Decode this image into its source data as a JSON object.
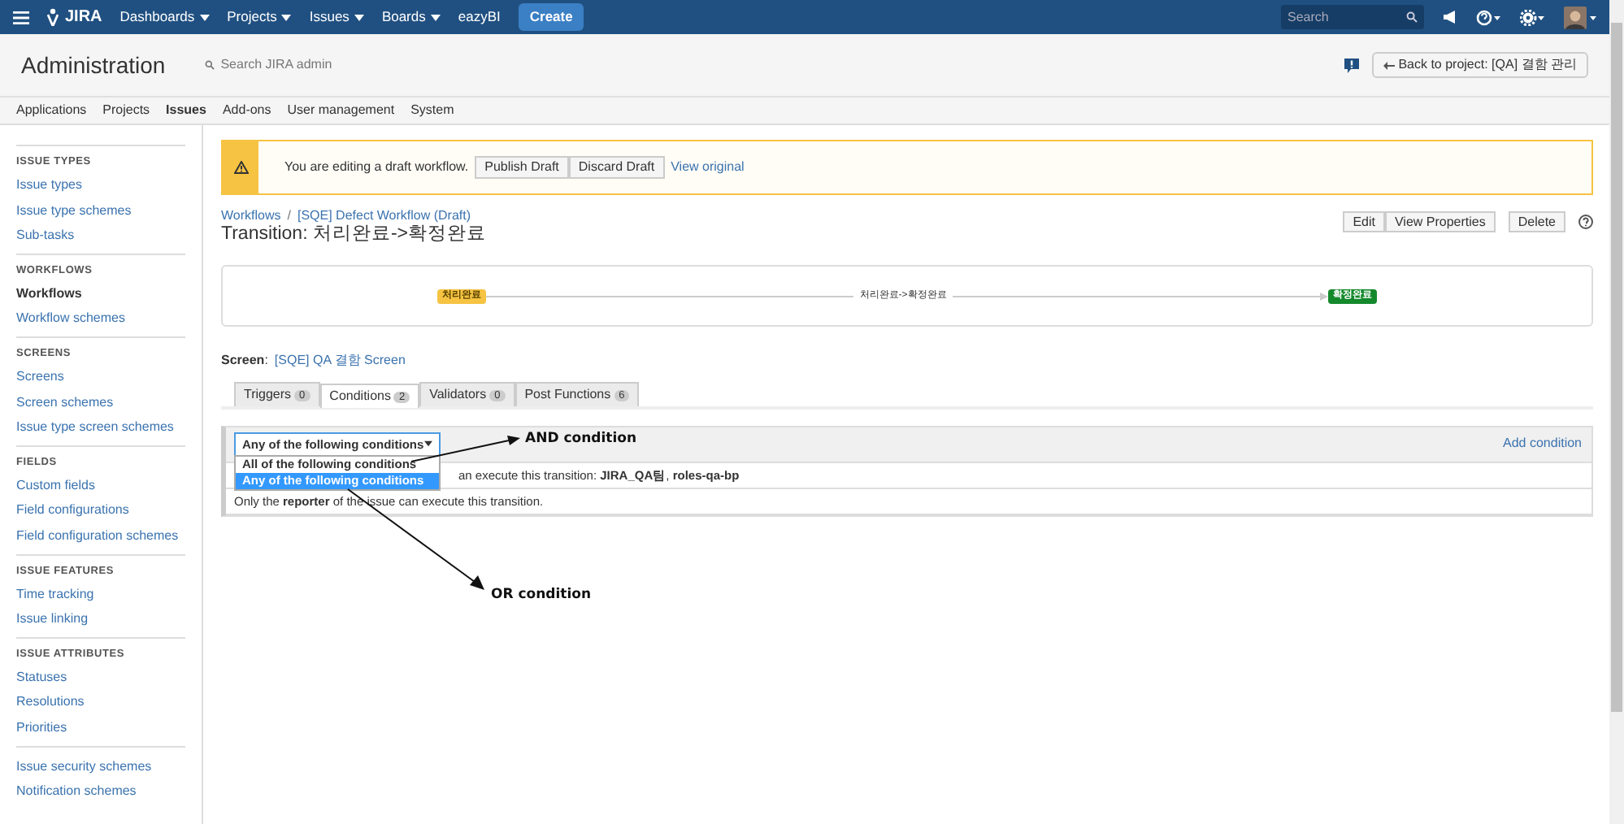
{
  "topbar": {
    "logo": "JIRA",
    "menus": [
      {
        "label": "Dashboards",
        "kind": "dropdown"
      },
      {
        "label": "Projects",
        "kind": "dropdown"
      },
      {
        "label": "Issues",
        "kind": "dropdown"
      },
      {
        "label": "Boards",
        "kind": "dropdown"
      },
      {
        "label": "eazyBI",
        "kind": "link"
      }
    ],
    "create": "Create",
    "search": {
      "placeholder": "Search"
    }
  },
  "header": {
    "title": "Administration",
    "search_admin": "Search JIRA admin",
    "back_button": "Back to project: [QA] 결함 관리"
  },
  "admin_tabs": [
    {
      "label": "Applications",
      "selected": false
    },
    {
      "label": "Projects",
      "selected": false
    },
    {
      "label": "Issues",
      "selected": true
    },
    {
      "label": "Add-ons",
      "selected": false
    },
    {
      "label": "User management",
      "selected": false
    },
    {
      "label": "System",
      "selected": false
    }
  ],
  "sidebar": {
    "sections": [
      {
        "heading": "ISSUE TYPES",
        "items": [
          {
            "label": "Issue types",
            "selected": false
          },
          {
            "label": "Issue type schemes",
            "selected": false
          },
          {
            "label": "Sub-tasks",
            "selected": false
          }
        ]
      },
      {
        "heading": "WORKFLOWS",
        "items": [
          {
            "label": "Workflows",
            "selected": true
          },
          {
            "label": "Workflow schemes",
            "selected": false
          }
        ]
      },
      {
        "heading": "SCREENS",
        "items": [
          {
            "label": "Screens",
            "selected": false
          },
          {
            "label": "Screen schemes",
            "selected": false
          },
          {
            "label": "Issue type screen schemes",
            "selected": false
          }
        ]
      },
      {
        "heading": "FIELDS",
        "items": [
          {
            "label": "Custom fields",
            "selected": false
          },
          {
            "label": "Field configurations",
            "selected": false
          },
          {
            "label": "Field configuration schemes",
            "selected": false
          }
        ]
      },
      {
        "heading": "ISSUE FEATURES",
        "items": [
          {
            "label": "Time tracking",
            "selected": false
          },
          {
            "label": "Issue linking",
            "selected": false
          }
        ]
      },
      {
        "heading": "ISSUE ATTRIBUTES",
        "items": [
          {
            "label": "Statuses",
            "selected": false
          },
          {
            "label": "Resolutions",
            "selected": false
          },
          {
            "label": "Priorities",
            "selected": false
          }
        ]
      },
      {
        "items": [
          {
            "label": "Issue security schemes",
            "selected": false
          },
          {
            "label": "Notification schemes",
            "selected": false
          }
        ]
      }
    ]
  },
  "draft_banner": {
    "message": "You are editing a draft workflow.",
    "buttons": [
      "Publish Draft",
      "Discard Draft"
    ],
    "link": "View original"
  },
  "breadcrumbs": [
    "Workflows",
    "[SQE] Defect Workflow (Draft)"
  ],
  "breadcrumb_separator": "/",
  "title": "Transition: 처리완료->확정완료",
  "actions": [
    "Edit",
    "View Properties"
  ],
  "delete_button": "Delete",
  "diagram": {
    "from": {
      "label": "처리완료",
      "color": "#f6c342"
    },
    "transition": "처리완료->확정완료",
    "to": {
      "label": "확정완료",
      "color": "#14892c"
    }
  },
  "screen": {
    "label": "Screen",
    "colon": ":",
    "link": "[SQE] QA 결함 Screen"
  },
  "tabs": [
    {
      "label": "Triggers",
      "count": "0",
      "selected": false
    },
    {
      "label": "Conditions",
      "count": "2",
      "selected": true
    },
    {
      "label": "Validators",
      "count": "0",
      "selected": false
    },
    {
      "label": "Post Functions",
      "count": "6",
      "selected": false
    }
  ],
  "conditions": {
    "dropdown": "Any of the following conditions",
    "options": [
      {
        "label": "All of the following conditions",
        "selected": false
      },
      {
        "label": "Any of the following conditions",
        "selected": true
      }
    ],
    "add_link": "Add condition",
    "rows": [
      "an execute this transition: **JIRA_QA팀**, **roles-qa-bp**",
      "Only the **reporter** of the issue can execute this transition."
    ]
  },
  "annotations": [
    "AND condition",
    "OR condition"
  ]
}
